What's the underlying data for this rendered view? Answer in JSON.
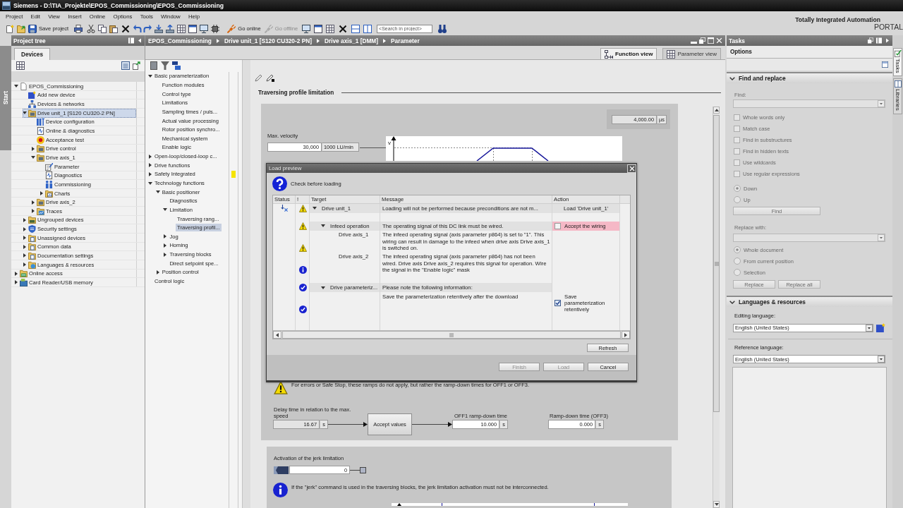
{
  "window": {
    "title": "Siemens - D:\\TIA_Projekte\\EPOS_Commissioning\\EPOS_Commissioning"
  },
  "menu": [
    "Project",
    "Edit",
    "View",
    "Insert",
    "Online",
    "Options",
    "Tools",
    "Window",
    "Help"
  ],
  "toolbar": {
    "buttons": [
      {
        "kind": "save",
        "label": "Save project",
        "disabled": false
      },
      {
        "kind": "online",
        "label": "Go online",
        "disabled": false
      },
      {
        "kind": "offline",
        "label": "Go offline",
        "disabled": true
      }
    ],
    "search": {
      "placeholder": "<Search in project>"
    }
  },
  "brand": {
    "name": "Totally Integrated Automation",
    "product": "PORTAL"
  },
  "start_tab": {
    "label": "Start"
  },
  "project_tree": {
    "title": "Project tree",
    "tabs": [
      {
        "label": "Devices",
        "selected": true
      }
    ],
    "items": [
      {
        "label": "EPOS_Commissioning",
        "kind": "project",
        "expandable": true,
        "expanded": true,
        "selected": false,
        "children": [
          {
            "label": "Add new device",
            "kind": "add",
            "expandable": false,
            "expanded": false,
            "selected": false
          },
          {
            "label": "Devices & networks",
            "kind": "network",
            "expandable": false,
            "expanded": false,
            "selected": false
          },
          {
            "label": "Drive unit_1 [S120 CU320-2 PN]",
            "kind": "drive",
            "expandable": true,
            "expanded": true,
            "selected": true,
            "children": [
              {
                "label": "Device configuration",
                "kind": "config",
                "expandable": false,
                "expanded": false,
                "selected": false
              },
              {
                "label": "Online & diagnostics",
                "kind": "diagnostics",
                "expandable": false,
                "expanded": false,
                "selected": false
              },
              {
                "label": "Acceptance test",
                "kind": "alert",
                "expandable": false,
                "expanded": false,
                "selected": false
              },
              {
                "label": "Drive control",
                "kind": "drive",
                "expandable": true,
                "expanded": false,
                "selected": false
              },
              {
                "label": "Drive axis_1",
                "kind": "drive",
                "expandable": true,
                "expanded": true,
                "selected": false,
                "children": [
                  {
                    "label": "Parameter",
                    "kind": "parameter",
                    "expandable": false,
                    "expanded": false,
                    "selected": false
                  },
                  {
                    "label": "Diagnostics",
                    "kind": "diagnostics",
                    "expandable": false,
                    "expanded": false,
                    "selected": false
                  },
                  {
                    "label": "Commissioning",
                    "kind": "commissioning",
                    "expandable": false,
                    "expanded": false,
                    "selected": false
                  },
                  {
                    "label": "Charts",
                    "kind": "chart",
                    "expandable": true,
                    "expanded": false,
                    "selected": false
                  }
                ]
              },
              {
                "label": "Drive axis_2",
                "kind": "drive",
                "expandable": true,
                "expanded": false,
                "selected": false
              },
              {
                "label": "Traces",
                "kind": "trace",
                "expandable": true,
                "expanded": false,
                "selected": false
              }
            ]
          },
          {
            "label": "Ungrouped devices",
            "kind": "devices",
            "expandable": true,
            "expanded": false,
            "selected": false
          },
          {
            "label": "Security settings",
            "kind": "security",
            "expandable": true,
            "expanded": false,
            "selected": false
          },
          {
            "label": "Unassigned devices",
            "kind": "unassigned",
            "expandable": true,
            "expanded": false,
            "selected": false
          },
          {
            "label": "Common data",
            "kind": "data",
            "expandable": true,
            "expanded": false,
            "selected": false
          },
          {
            "label": "Documentation settings",
            "kind": "docs",
            "expandable": true,
            "expanded": false,
            "selected": false
          },
          {
            "label": "Languages & resources",
            "kind": "languages",
            "expandable": true,
            "expanded": false,
            "selected": false
          }
        ]
      },
      {
        "label": "Online access",
        "kind": "online",
        "expandable": true,
        "expanded": false,
        "selected": false
      },
      {
        "label": "Card Reader/USB memory",
        "kind": "card",
        "expandable": true,
        "expanded": false,
        "selected": false
      }
    ]
  },
  "editor": {
    "breadcrumb": [
      "EPOS_Commissioning",
      "Drive unit_1 [S120 CU320-2 PN]",
      "Drive axis_1 [DMM]",
      "Parameter"
    ],
    "views": [
      {
        "label": "Function view",
        "selected": true
      },
      {
        "label": "Parameter view",
        "selected": false
      }
    ],
    "nav": [
      {
        "label": "Basic parameterization",
        "expandable": true,
        "expanded": true,
        "selected": false,
        "children": [
          {
            "label": "Function modules",
            "expandable": false,
            "expanded": false,
            "selected": false
          },
          {
            "label": "Control type",
            "expandable": false,
            "expanded": false,
            "selected": false
          },
          {
            "label": "Limitations",
            "expandable": false,
            "expanded": false,
            "selected": false
          },
          {
            "label": "Sampling times / puls...",
            "expandable": false,
            "expanded": false,
            "selected": false
          },
          {
            "label": "Actual value processing",
            "expandable": false,
            "expanded": false,
            "selected": false
          },
          {
            "label": "Rotor position synchro...",
            "expandable": false,
            "expanded": false,
            "selected": false
          },
          {
            "label": "Mechanical system",
            "expandable": false,
            "expanded": false,
            "selected": false
          },
          {
            "label": "Enable logic",
            "expandable": false,
            "expanded": false,
            "selected": false
          }
        ]
      },
      {
        "label": "Open-loop/closed-loop c...",
        "expandable": true,
        "expanded": false,
        "selected": false
      },
      {
        "label": "Drive functions",
        "expandable": true,
        "expanded": false,
        "selected": false
      },
      {
        "label": "Safety Integrated",
        "expandable": true,
        "expanded": false,
        "selected": false,
        "color": "#f5e400"
      },
      {
        "label": "Technology functions",
        "expandable": true,
        "expanded": true,
        "selected": false,
        "children": [
          {
            "label": "Basic positioner",
            "expandable": true,
            "expanded": true,
            "selected": false,
            "children": [
              {
                "label": "Diagnostics",
                "expandable": false,
                "expanded": false,
                "selected": false
              },
              {
                "label": "Limitation",
                "expandable": true,
                "expanded": true,
                "selected": false,
                "children": [
                  {
                    "label": "Traversing rang...",
                    "expandable": false,
                    "expanded": false,
                    "selected": false
                  },
                  {
                    "label": "Traversing profil...",
                    "expandable": false,
                    "expanded": false,
                    "selected": true
                  }
                ]
              },
              {
                "label": "Jog",
                "expandable": true,
                "expanded": false,
                "selected": false
              },
              {
                "label": "Homing",
                "expandable": true,
                "expanded": false,
                "selected": false
              },
              {
                "label": "Traversing blocks",
                "expandable": true,
                "expanded": false,
                "selected": false
              },
              {
                "label": "Direct setpoint spe...",
                "expandable": false,
                "expanded": false,
                "selected": false
              }
            ]
          },
          {
            "label": "Position control",
            "expandable": true,
            "expanded": false,
            "selected": false
          }
        ]
      },
      {
        "label": "Control logic",
        "expandable": false,
        "expanded": false,
        "selected": false
      }
    ],
    "section_title": "Traversing profile limitation",
    "cycle_time": {
      "value": "4,000.00",
      "unit": "µs",
      "readonly": true
    },
    "max_velocity": {
      "label": "Max. velocity",
      "value": "30,000",
      "unit": "1000 LU/min",
      "readonly": false
    },
    "profile_axis_label": "v",
    "ramp_note": "For errors or Safe Stop, these ramps do not apply, but rather the ramp-down times for OFF1 or OFF3.",
    "delay_time": {
      "label": "Delay time in relation to the max. speed",
      "value": "16.67",
      "unit": "s",
      "readonly": true
    },
    "accept_button": "Accept values",
    "off1": {
      "label": "OFF1 ramp-down time",
      "value": "10.000",
      "unit": "s",
      "readonly": false
    },
    "off3": {
      "label": "Ramp-down time (OFF3)",
      "value": "0.000",
      "unit": "s",
      "readonly": false
    },
    "jerk": {
      "label": "Activation of the jerk limitation",
      "value": "0"
    },
    "jerk_note": "If the \"jerk\" command is used in the traversing blocks, the jerk limitation activation must not be interconnected."
  },
  "dialog": {
    "title": "Load preview",
    "heading": "Check before loading",
    "columns": [
      "Status",
      "!",
      "Target",
      "Message",
      "Action"
    ],
    "rows": [
      {
        "blocked": true,
        "kind": "warning",
        "target": "Drive unit_1",
        "expanded": true,
        "message": "Loading will not be performed because preconditions are not m...",
        "action": {
          "kind": "text",
          "label": "Load 'Drive unit_1'"
        },
        "children": [
          {
            "blocked": false,
            "kind": "warning",
            "target": "Infeed operation",
            "expanded": true,
            "message": "The operating signal of this DC link must be wired.",
            "action": {
              "kind": "checkbox",
              "label": "Accept the wiring",
              "checked": false,
              "highlighted": true
            },
            "children": [
              {
                "blocked": false,
                "kind": "warning",
                "target": "Drive axis_1",
                "expanded": false,
                "message": "The infeed operating signal (axis parameter p864) is set to \"1\". This wiring can result in damage to the infeed when drive axis Drive axis_1 is switched on."
              },
              {
                "blocked": false,
                "kind": "info",
                "target": "Drive axis_2",
                "expanded": false,
                "message": "The infeed operating signal (axis parameter p864) has not been wired. Drive axis Drive axis_2 requires this signal for operation. Wire the signal in the \"Enable logic\" mask"
              }
            ]
          },
          {
            "blocked": false,
            "kind": "ok",
            "target": "Drive parameteriz...",
            "expanded": true,
            "message": "Please note the following information:",
            "children": [
              {
                "blocked": false,
                "kind": "ok",
                "expanded": false,
                "message": "Save the parameterization retentively after the download",
                "action": {
                  "kind": "checkbox",
                  "label": "Save parameterization retentively",
                  "checked": true,
                  "highlighted": false
                }
              }
            ]
          }
        ]
      }
    ],
    "refresh": "Refresh",
    "buttons": [
      {
        "label": "Finish",
        "disabled": true
      },
      {
        "label": "Load",
        "disabled": true
      },
      {
        "label": "Cancel",
        "disabled": false
      }
    ]
  },
  "tasks": {
    "title": "Tasks",
    "pane": "Options",
    "find_replace": {
      "title": "Find and replace",
      "expanded": true,
      "disabled": true,
      "find_label": "Find:",
      "options": [
        {
          "label": "Whole words only",
          "checked": false
        },
        {
          "label": "Match case",
          "checked": false
        },
        {
          "label": "Find in substructures",
          "checked": false
        },
        {
          "label": "Find in hidden texts",
          "checked": false
        },
        {
          "label": "Use wildcards",
          "checked": false
        },
        {
          "label": "Use regular expressions",
          "checked": false
        }
      ],
      "direction": [
        {
          "label": "Down",
          "selected": true
        },
        {
          "label": "Up",
          "selected": false
        }
      ],
      "find_button": "Find",
      "replace_label": "Replace with:",
      "scope": [
        {
          "label": "Whole document",
          "selected": true
        },
        {
          "label": "From current position",
          "selected": false
        },
        {
          "label": "Selection",
          "selected": false
        }
      ],
      "replace_buttons": [
        "Replace",
        "Replace all"
      ]
    },
    "languages": {
      "title": "Languages & resources",
      "expanded": true,
      "editing_label": "Editing language:",
      "editing_value": "English (United States)",
      "reference_label": "Reference language:",
      "reference_value": "English (United States)"
    }
  },
  "side_tabs": [
    {
      "label": "Tasks",
      "selected": true
    },
    {
      "label": "Libraries",
      "selected": false
    }
  ]
}
